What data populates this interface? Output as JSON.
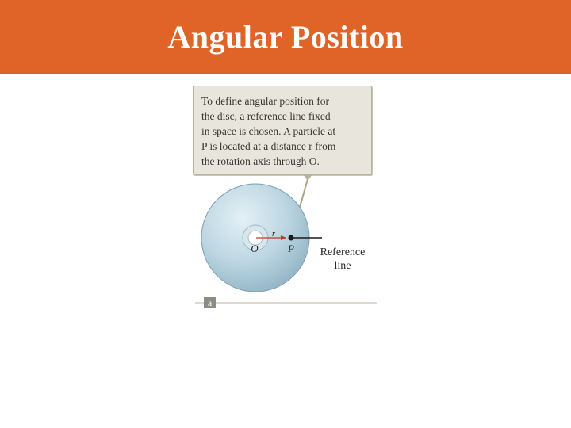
{
  "slide": {
    "title": "Angular Position"
  },
  "callout": {
    "lines": [
      "To define angular position for",
      "the disc, a reference line fixed",
      "in space is chosen. A particle at",
      "P is located at a distance r from",
      "the rotation axis through O."
    ]
  },
  "figure": {
    "labels": {
      "origin": "O",
      "particle": "P",
      "radius": "r",
      "reference_line_1": "Reference",
      "reference_line_2": "line",
      "panel": "a"
    },
    "colors": {
      "header": "#e06428",
      "disc": "#bcd6e2",
      "radius_arrow": "#c0392b",
      "callout_bg": "#e8e6dc",
      "leader": "#a8a488"
    }
  }
}
